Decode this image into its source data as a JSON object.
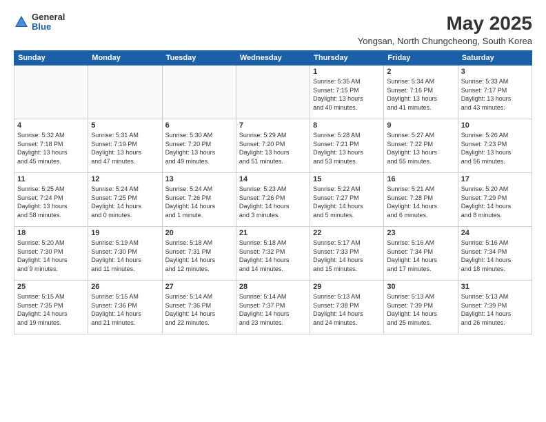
{
  "logo": {
    "general": "General",
    "blue": "Blue"
  },
  "title": "May 2025",
  "subtitle": "Yongsan, North Chungcheong, South Korea",
  "days_of_week": [
    "Sunday",
    "Monday",
    "Tuesday",
    "Wednesday",
    "Thursday",
    "Friday",
    "Saturday"
  ],
  "weeks": [
    [
      {
        "day": "",
        "text": ""
      },
      {
        "day": "",
        "text": ""
      },
      {
        "day": "",
        "text": ""
      },
      {
        "day": "",
        "text": ""
      },
      {
        "day": "1",
        "text": "Sunrise: 5:35 AM\nSunset: 7:15 PM\nDaylight: 13 hours\nand 40 minutes."
      },
      {
        "day": "2",
        "text": "Sunrise: 5:34 AM\nSunset: 7:16 PM\nDaylight: 13 hours\nand 41 minutes."
      },
      {
        "day": "3",
        "text": "Sunrise: 5:33 AM\nSunset: 7:17 PM\nDaylight: 13 hours\nand 43 minutes."
      }
    ],
    [
      {
        "day": "4",
        "text": "Sunrise: 5:32 AM\nSunset: 7:18 PM\nDaylight: 13 hours\nand 45 minutes."
      },
      {
        "day": "5",
        "text": "Sunrise: 5:31 AM\nSunset: 7:19 PM\nDaylight: 13 hours\nand 47 minutes."
      },
      {
        "day": "6",
        "text": "Sunrise: 5:30 AM\nSunset: 7:20 PM\nDaylight: 13 hours\nand 49 minutes."
      },
      {
        "day": "7",
        "text": "Sunrise: 5:29 AM\nSunset: 7:20 PM\nDaylight: 13 hours\nand 51 minutes."
      },
      {
        "day": "8",
        "text": "Sunrise: 5:28 AM\nSunset: 7:21 PM\nDaylight: 13 hours\nand 53 minutes."
      },
      {
        "day": "9",
        "text": "Sunrise: 5:27 AM\nSunset: 7:22 PM\nDaylight: 13 hours\nand 55 minutes."
      },
      {
        "day": "10",
        "text": "Sunrise: 5:26 AM\nSunset: 7:23 PM\nDaylight: 13 hours\nand 56 minutes."
      }
    ],
    [
      {
        "day": "11",
        "text": "Sunrise: 5:25 AM\nSunset: 7:24 PM\nDaylight: 13 hours\nand 58 minutes."
      },
      {
        "day": "12",
        "text": "Sunrise: 5:24 AM\nSunset: 7:25 PM\nDaylight: 14 hours\nand 0 minutes."
      },
      {
        "day": "13",
        "text": "Sunrise: 5:24 AM\nSunset: 7:26 PM\nDaylight: 14 hours\nand 1 minute."
      },
      {
        "day": "14",
        "text": "Sunrise: 5:23 AM\nSunset: 7:26 PM\nDaylight: 14 hours\nand 3 minutes."
      },
      {
        "day": "15",
        "text": "Sunrise: 5:22 AM\nSunset: 7:27 PM\nDaylight: 14 hours\nand 5 minutes."
      },
      {
        "day": "16",
        "text": "Sunrise: 5:21 AM\nSunset: 7:28 PM\nDaylight: 14 hours\nand 6 minutes."
      },
      {
        "day": "17",
        "text": "Sunrise: 5:20 AM\nSunset: 7:29 PM\nDaylight: 14 hours\nand 8 minutes."
      }
    ],
    [
      {
        "day": "18",
        "text": "Sunrise: 5:20 AM\nSunset: 7:30 PM\nDaylight: 14 hours\nand 9 minutes."
      },
      {
        "day": "19",
        "text": "Sunrise: 5:19 AM\nSunset: 7:30 PM\nDaylight: 14 hours\nand 11 minutes."
      },
      {
        "day": "20",
        "text": "Sunrise: 5:18 AM\nSunset: 7:31 PM\nDaylight: 14 hours\nand 12 minutes."
      },
      {
        "day": "21",
        "text": "Sunrise: 5:18 AM\nSunset: 7:32 PM\nDaylight: 14 hours\nand 14 minutes."
      },
      {
        "day": "22",
        "text": "Sunrise: 5:17 AM\nSunset: 7:33 PM\nDaylight: 14 hours\nand 15 minutes."
      },
      {
        "day": "23",
        "text": "Sunrise: 5:16 AM\nSunset: 7:34 PM\nDaylight: 14 hours\nand 17 minutes."
      },
      {
        "day": "24",
        "text": "Sunrise: 5:16 AM\nSunset: 7:34 PM\nDaylight: 14 hours\nand 18 minutes."
      }
    ],
    [
      {
        "day": "25",
        "text": "Sunrise: 5:15 AM\nSunset: 7:35 PM\nDaylight: 14 hours\nand 19 minutes."
      },
      {
        "day": "26",
        "text": "Sunrise: 5:15 AM\nSunset: 7:36 PM\nDaylight: 14 hours\nand 21 minutes."
      },
      {
        "day": "27",
        "text": "Sunrise: 5:14 AM\nSunset: 7:36 PM\nDaylight: 14 hours\nand 22 minutes."
      },
      {
        "day": "28",
        "text": "Sunrise: 5:14 AM\nSunset: 7:37 PM\nDaylight: 14 hours\nand 23 minutes."
      },
      {
        "day": "29",
        "text": "Sunrise: 5:13 AM\nSunset: 7:38 PM\nDaylight: 14 hours\nand 24 minutes."
      },
      {
        "day": "30",
        "text": "Sunrise: 5:13 AM\nSunset: 7:39 PM\nDaylight: 14 hours\nand 25 minutes."
      },
      {
        "day": "31",
        "text": "Sunrise: 5:13 AM\nSunset: 7:39 PM\nDaylight: 14 hours\nand 26 minutes."
      }
    ]
  ]
}
